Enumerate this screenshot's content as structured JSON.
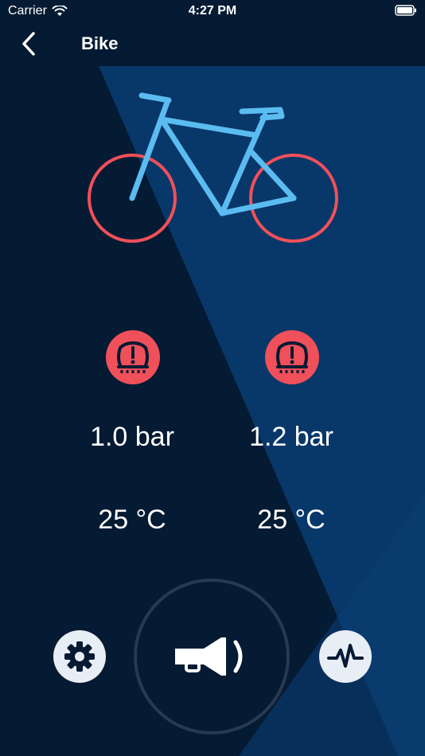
{
  "status_bar": {
    "carrier": "Carrier",
    "time": "4:27 PM"
  },
  "nav": {
    "title": "Bike"
  },
  "tires": [
    {
      "pressure": "1.0 bar",
      "temperature": "25 °C"
    },
    {
      "pressure": "1.2 bar",
      "temperature": "25 °C"
    }
  ],
  "colors": {
    "background": "#051a33",
    "accent_blue": "#5bbcf0",
    "alert_red": "#f0505a"
  },
  "icons": [
    "back-chevron-icon",
    "bicycle-icon",
    "tire-pressure-warning-icon",
    "gear-icon",
    "horn-icon",
    "activity-icon"
  ]
}
